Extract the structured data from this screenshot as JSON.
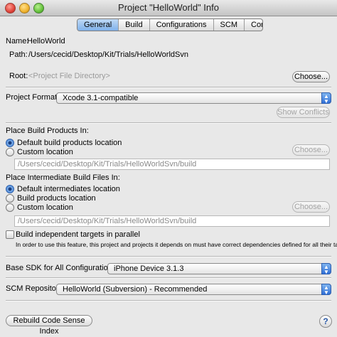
{
  "window": {
    "title": "Project \"HelloWorld\" Info"
  },
  "tabs": [
    {
      "label": "General"
    },
    {
      "label": "Build"
    },
    {
      "label": "Configurations"
    },
    {
      "label": "SCM"
    },
    {
      "label": "Comments"
    }
  ],
  "general": {
    "name_label": "Name:",
    "name_value": "HelloWorld",
    "path_label": "Path:",
    "path_value": "/Users/cecid/Desktop/Kit/Trials/HelloWorldSvn",
    "root_label": "Root:",
    "root_value": "<Project File Directory>",
    "choose_button": "Choose...",
    "format_label": "Project Format:",
    "format_value": "Xcode 3.1-compatible",
    "show_conflicts": "Show Conflicts"
  },
  "build_products": {
    "heading": "Place Build Products In:",
    "option_default": "Default build products location",
    "option_custom": "Custom location",
    "choose_button": "Choose...",
    "custom_path": "/Users/cecid/Desktop/Kit/Trials/HelloWorldSvn/build"
  },
  "intermediates": {
    "heading": "Place Intermediate Build Files In:",
    "option_default": "Default intermediates location",
    "option_build_products": "Build products location",
    "option_custom": "Custom location",
    "choose_button": "Choose...",
    "custom_path": "/Users/cecid/Desktop/Kit/Trials/HelloWorldSvn/build"
  },
  "parallel": {
    "label": "Build independent targets in parallel",
    "note": "In order to use this feature, this project and projects it depends on must have correct dependencies defined for all their targets.",
    "checked": false
  },
  "sdk": {
    "label": "Base SDK for All Configurations:",
    "value": "iPhone Device 3.1.3"
  },
  "scm": {
    "label": "SCM Repository:",
    "value": "HelloWorld (Subversion) - Recommended"
  },
  "footer": {
    "rebuild_button": "Rebuild Code Sense Index",
    "help_glyph": "?"
  }
}
